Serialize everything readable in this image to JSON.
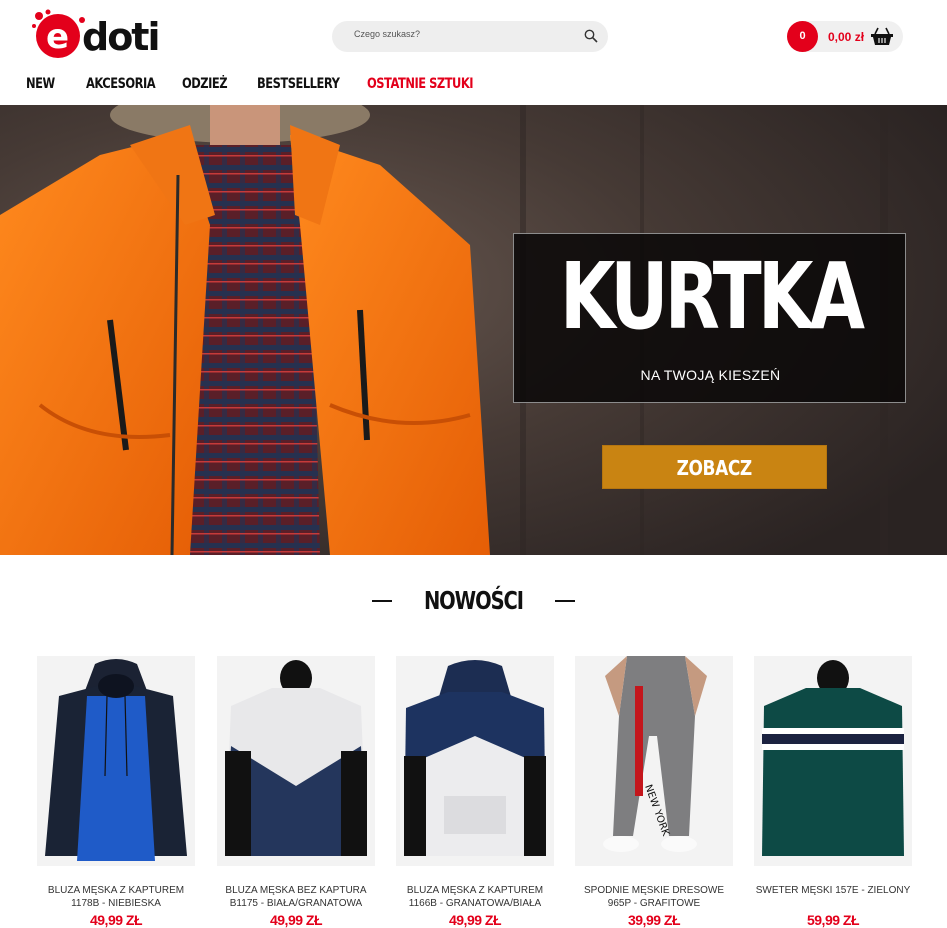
{
  "header": {
    "search_placeholder": "Czego szukasz?",
    "cart_count": "0",
    "cart_total": "0,00 zł"
  },
  "nav": [
    {
      "label": "NEW"
    },
    {
      "label": "AKCESORIA"
    },
    {
      "label": "ODZIEŻ"
    },
    {
      "label": "BESTSELLERY"
    },
    {
      "label": "OSTATNIE SZTUKI"
    }
  ],
  "hero": {
    "title": "KURTKA",
    "subtitle": "NA TWOJĄ KIESZEŃ",
    "button": "ZOBACZ"
  },
  "section": {
    "title": "NOWOŚCI"
  },
  "products": [
    {
      "name": "BLUZA MĘSKA Z KAPTUREM 1178B - NIEBIESKA",
      "price": "49,99 ZŁ"
    },
    {
      "name": "BLUZA MĘSKA BEZ KAPTURA B1175 - BIAŁA/GRANATOWA",
      "price": "49,99 ZŁ"
    },
    {
      "name": "BLUZA MĘSKA Z KAPTUREM 1166B - GRANATOWA/BIAŁA",
      "price": "49,99 ZŁ"
    },
    {
      "name": "SPODNIE MĘSKIE DRESOWE 965P - GRAFITOWE",
      "price": "39,99 ZŁ"
    },
    {
      "name": "SWETER MĘSKI 157E - ZIELONY",
      "price": "59,99 ZŁ"
    }
  ],
  "colors": {
    "accent": "#e3001b",
    "button": "#c98412"
  },
  "icons": {
    "search": "magnifier-icon",
    "cart": "basket-icon",
    "logo": "edoti-logo"
  }
}
